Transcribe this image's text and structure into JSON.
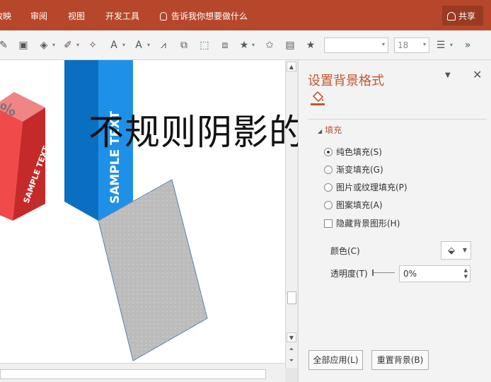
{
  "ribbon": {
    "tabs": [
      "放映",
      "审阅",
      "视图",
      "开发工具"
    ],
    "tell_me": "告诉我你想要做什么",
    "share_label": "共享",
    "bg_color": "#b7472a"
  },
  "toolbar": {
    "font_name": "",
    "font_size": "18"
  },
  "slide": {
    "headline": "不规则阴影的设计",
    "percent_text": "%",
    "red_box_text": "SAMPLE TEXT",
    "blue_box_text": "SAMPLE TEXT",
    "colors": {
      "red": "#e23a3a",
      "blue": "#0b7ed3",
      "shadow": "#bcbcbc"
    }
  },
  "format_pane": {
    "title": "设置背景格式",
    "section": "填充",
    "options": [
      {
        "label": "纯色填充(S)",
        "selected": true
      },
      {
        "label": "渐变填充(G)",
        "selected": false
      },
      {
        "label": "图片或纹理填充(P)",
        "selected": false
      },
      {
        "label": "图案填充(A)",
        "selected": false
      }
    ],
    "hide_bg_graphics": "隐藏背景图形(H)",
    "color_label": "颜色(C)",
    "transparency_label": "透明度(T)",
    "transparency_value": "0%",
    "apply_all": "全部应用(L)",
    "reset_bg": "重置背景(B)"
  }
}
